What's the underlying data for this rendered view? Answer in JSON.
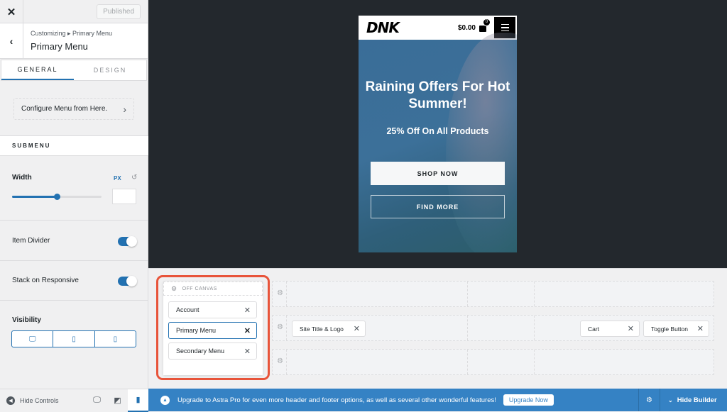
{
  "sidebar": {
    "close_label": "✕",
    "publish_label": "Published",
    "breadcrumb": "Customizing ▸ Primary Menu",
    "title": "Primary Menu",
    "tabs": [
      {
        "label": "GENERAL",
        "active": true
      },
      {
        "label": "DESIGN",
        "active": false
      }
    ],
    "configure_label": "Configure Menu from Here.",
    "section_title": "SUBMENU",
    "width": {
      "label": "Width",
      "unit": "PX",
      "slider_percent": 50,
      "value": ""
    },
    "item_divider": {
      "label": "Item Divider",
      "on": true
    },
    "stack_responsive": {
      "label": "Stack on Responsive",
      "on": true
    },
    "visibility": {
      "label": "Visibility",
      "options": [
        "desktop",
        "tablet",
        "mobile"
      ]
    }
  },
  "footer": {
    "hide_controls": "Hide Controls",
    "devices": [
      "desktop",
      "tablet",
      "mobile"
    ],
    "active_device": "mobile"
  },
  "preview": {
    "logo": "DNK",
    "cart_total": "$0.00",
    "cart_count": "0",
    "hero_title": "Raining Offers For Hot Summer!",
    "hero_subtitle": "25% Off On All Products",
    "primary_cta": "SHOP NOW",
    "secondary_cta": "FIND MORE"
  },
  "builder": {
    "off_canvas": {
      "title": "OFF CANVAS",
      "items": [
        {
          "label": "Account",
          "selected": false
        },
        {
          "label": "Primary Menu",
          "selected": true
        },
        {
          "label": "Secondary Menu",
          "selected": false
        }
      ]
    },
    "rows": [
      {
        "chips": []
      },
      {
        "chips": [
          "Site Title & Logo",
          "Cart",
          "Toggle Button"
        ]
      },
      {
        "chips": []
      }
    ]
  },
  "notice": {
    "text": "Upgrade to Astra Pro for even more header and footer options, as well as several other wonderful features!",
    "button": "Upgrade Now",
    "hide_builder": "Hide Builder"
  }
}
